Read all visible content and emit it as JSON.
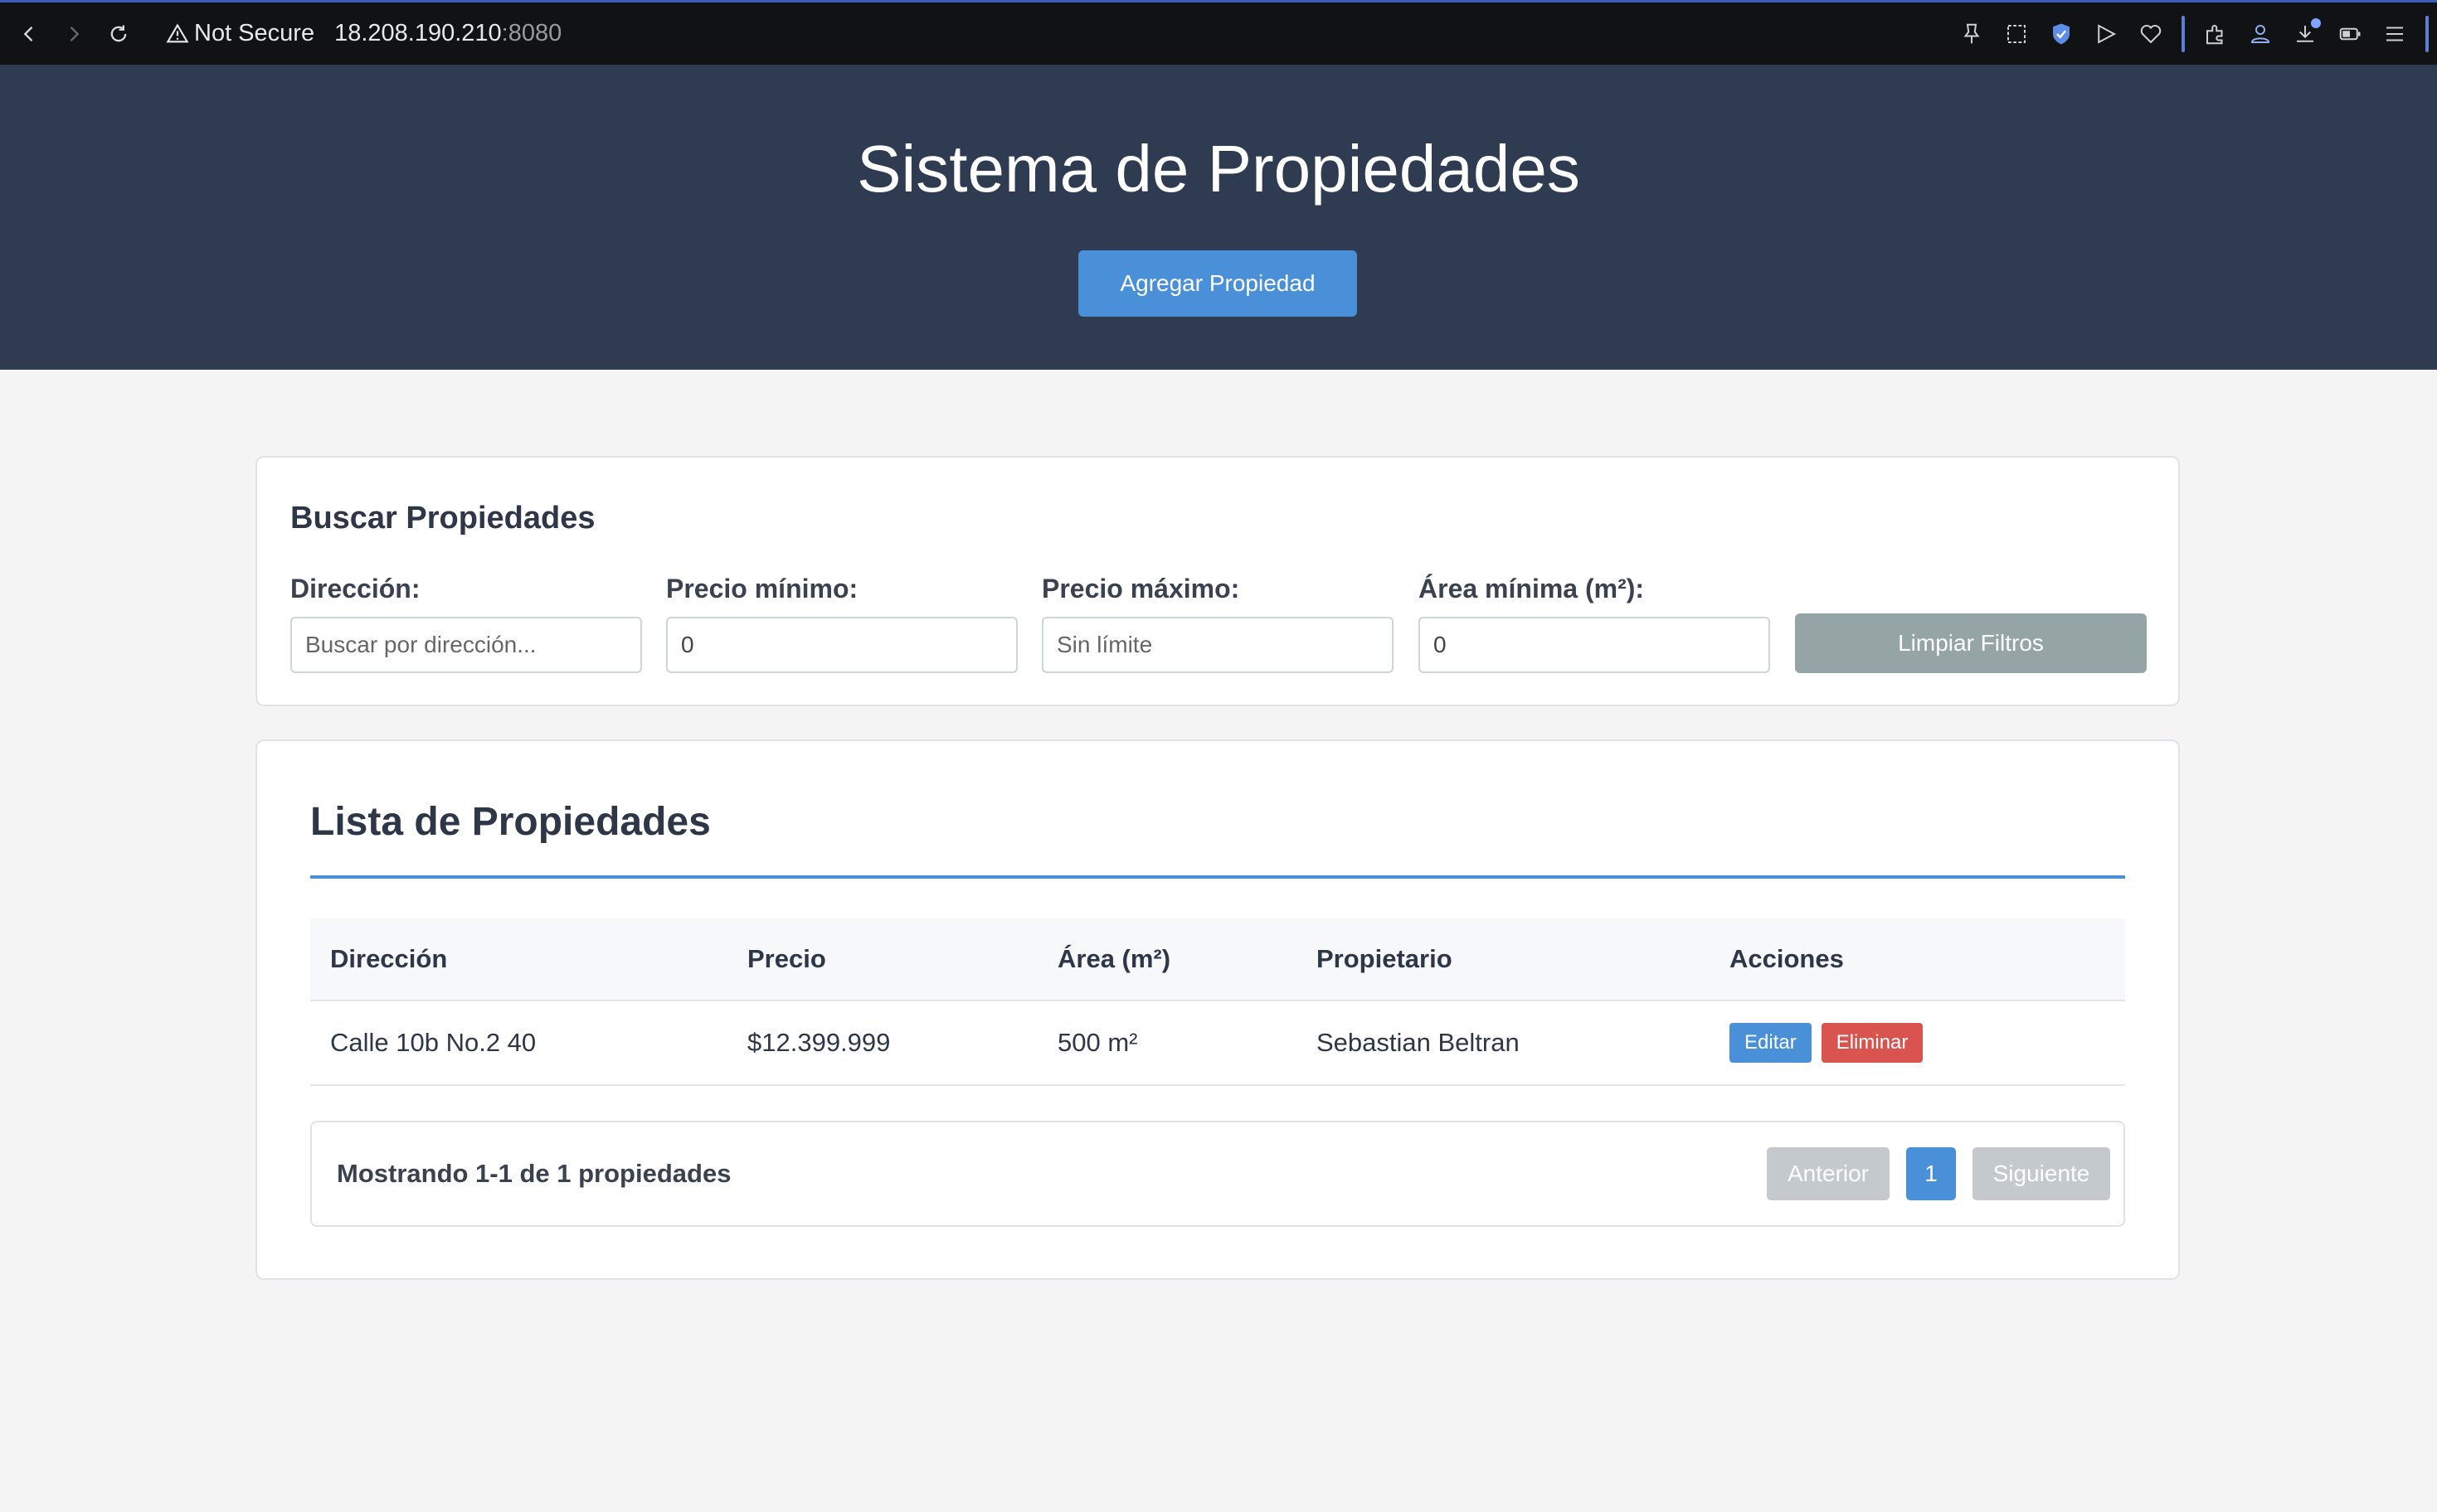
{
  "browser": {
    "security_label": "Not Secure",
    "url_host": "18.208.190.210",
    "url_port": ":8080"
  },
  "header": {
    "title": "Sistema de Propiedades",
    "add_button": "Agregar Propiedad"
  },
  "search": {
    "title": "Buscar Propiedades",
    "fields": [
      {
        "label": "Dirección:",
        "placeholder": "Buscar por dirección...",
        "value": ""
      },
      {
        "label": "Precio mínimo:",
        "placeholder": "",
        "value": "0"
      },
      {
        "label": "Precio máximo:",
        "placeholder": "Sin límite",
        "value": ""
      },
      {
        "label": "Área mínima (m²):",
        "placeholder": "",
        "value": "0"
      }
    ],
    "clear_button": "Limpiar Filtros"
  },
  "list": {
    "title": "Lista de Propiedades",
    "columns": [
      "Dirección",
      "Precio",
      "Área (m²)",
      "Propietario",
      "Acciones"
    ],
    "rows": [
      {
        "direccion": "Calle 10b No.2 40",
        "precio": "$12.399.999",
        "area": "500 m²",
        "propietario": "Sebastian Beltran",
        "edit": "Editar",
        "delete": "Eliminar"
      }
    ],
    "pagination": {
      "info": "Mostrando 1-1 de 1 propiedades",
      "prev": "Anterior",
      "current_page": "1",
      "next": "Siguiente"
    }
  }
}
